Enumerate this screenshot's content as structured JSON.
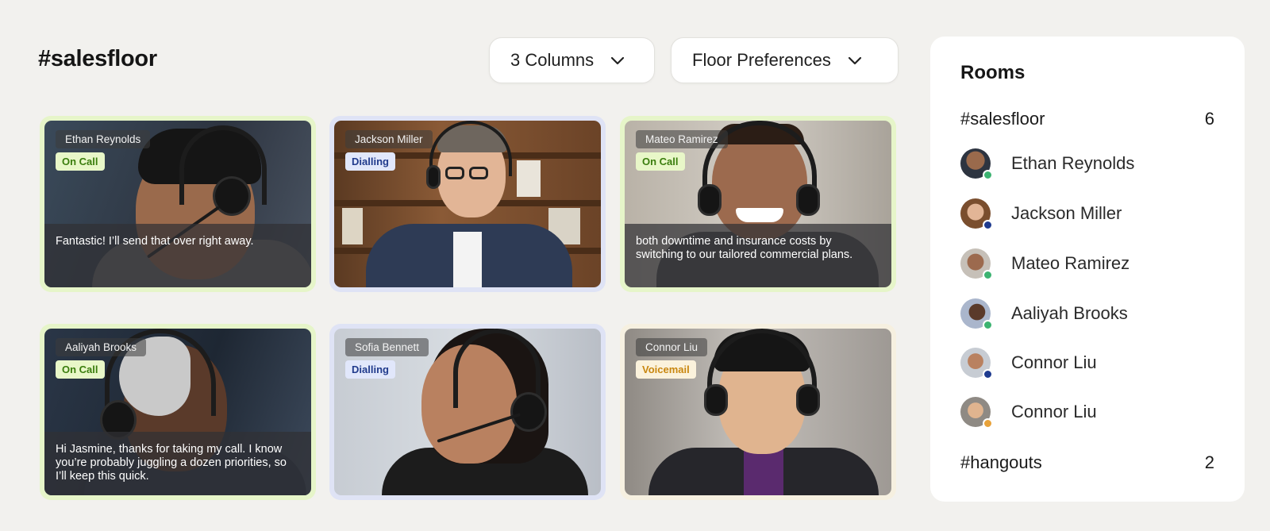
{
  "header": {
    "title": "#salesfloor",
    "columns_dropdown": "3 Columns",
    "floor_dropdown": "Floor Preferences"
  },
  "tiles": [
    {
      "name": "Ethan Reynolds",
      "status": "On Call",
      "transcript": "Fantastic! I’ll send that over right away."
    },
    {
      "name": "Jackson Miller",
      "status": "Dialling",
      "transcript": ""
    },
    {
      "name": "Mateo Ramirez",
      "status": "On Call",
      "transcript": "both downtime and insurance costs by switching to our tailored commercial plans."
    },
    {
      "name": "Aaliyah Brooks",
      "status": "On Call",
      "transcript": "Hi Jasmine, thanks for taking my call. I know you’re probably juggling a dozen priorities, so I’ll keep this quick."
    },
    {
      "name": "Sofia Bennett",
      "status": "Dialling",
      "transcript": ""
    },
    {
      "name": "Connor Liu",
      "status": "Voicemail",
      "transcript": ""
    }
  ],
  "rooms": {
    "title": "Rooms",
    "salesfloor": {
      "name": "#salesfloor",
      "count": "6"
    },
    "members": [
      {
        "name": "Ethan Reynolds",
        "presence": "#3cb371"
      },
      {
        "name": "Jackson Miller",
        "presence": "#1f3b8f"
      },
      {
        "name": "Mateo Ramirez",
        "presence": "#3cb371"
      },
      {
        "name": "Aaliyah Brooks",
        "presence": "#3cb371"
      },
      {
        "name": "Connor Liu",
        "presence": "#1f3b8f"
      },
      {
        "name": "Connor Liu",
        "presence": "#e8a23a"
      }
    ],
    "hangouts": {
      "name": "#hangouts",
      "count": "2"
    }
  },
  "colors": {
    "on_call": "#3a7d0d",
    "dialling": "#213b8c",
    "voicemail": "#c98710",
    "on_call_border": "#e6f5c9",
    "dialling_border": "#dfe3f5",
    "voicemail_border": "#f6f0e0"
  },
  "icons": [
    "chevron-down-icon"
  ]
}
